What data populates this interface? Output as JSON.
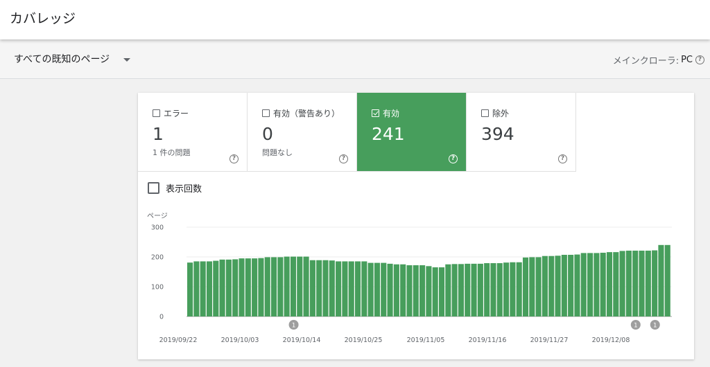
{
  "header": {
    "title": "カバレッジ"
  },
  "filters": {
    "property_label": "すべての既知のページ",
    "crawler_label": "メインクローラ:",
    "crawler_value": "PC"
  },
  "tiles": [
    {
      "label": "エラー",
      "value": "1",
      "sub": "1 件の問題",
      "checked": false
    },
    {
      "label": "有効（警告あり）",
      "value": "0",
      "sub": "問題なし",
      "checked": false
    },
    {
      "label": "有効",
      "value": "241",
      "sub": "",
      "checked": true
    },
    {
      "label": "除外",
      "value": "394",
      "sub": "",
      "checked": false
    }
  ],
  "impressions_label": "表示回数",
  "colors": {
    "accent": "#479e5c",
    "bar": "#479e5c",
    "annotation": "#9e9e9e"
  },
  "chart_data": {
    "type": "bar",
    "ylabel": "ページ",
    "ylim": [
      0,
      300
    ],
    "yticks": [
      "0",
      "100",
      "200",
      "300"
    ],
    "xtick_labels": [
      "2019/09/22",
      "2019/10/03",
      "2019/10/14",
      "2019/10/25",
      "2019/11/05",
      "2019/11/16",
      "2019/11/27",
      "2019/12/08"
    ],
    "series": [
      {
        "values": [
          181,
          185,
          185,
          185,
          187,
          191,
          191,
          192,
          195,
          195,
          195,
          196,
          199,
          199,
          199,
          201,
          201,
          201,
          201,
          189,
          189,
          189,
          188,
          185,
          185,
          185,
          185,
          185,
          180,
          180,
          180,
          177,
          175,
          175,
          172,
          172,
          172,
          169,
          165,
          165,
          175,
          176,
          176,
          177,
          177,
          177,
          179,
          179,
          179,
          181,
          182,
          182,
          198,
          199,
          199,
          203,
          203,
          204,
          207,
          207,
          208,
          213,
          213,
          213,
          214,
          216,
          216,
          220,
          221,
          221,
          221,
          221,
          222,
          240,
          240
        ]
      }
    ],
    "annotations": [
      {
        "x_index": 16,
        "label": "1"
      },
      {
        "x_index": 69,
        "label": "1"
      },
      {
        "x_index": 72,
        "label": "1"
      }
    ]
  }
}
